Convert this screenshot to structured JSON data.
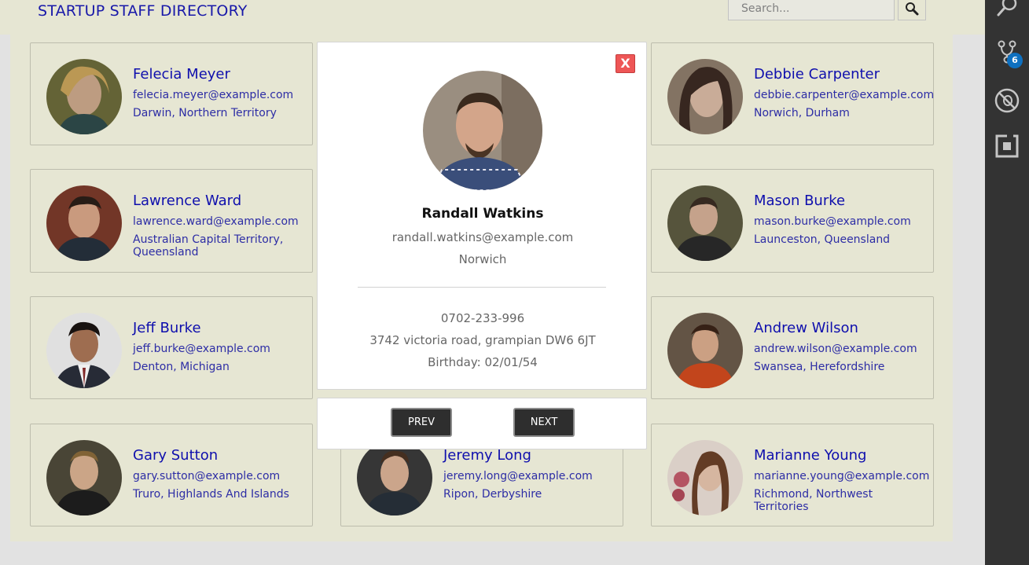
{
  "header": {
    "title": "STARTUP STAFF DIRECTORY",
    "search_placeholder": "Search..."
  },
  "cards": [
    {
      "name": "Felecia Meyer",
      "email": "felecia.meyer@example.com",
      "location": "Darwin, Northern Territory"
    },
    {
      "name": "Debbie Carpenter",
      "email": "debbie.carpenter@example.com",
      "location": "Norwich, Durham"
    },
    {
      "name": "Lawrence Ward",
      "email": "lawrence.ward@example.com",
      "location": "Australian Capital Territory, Queensland"
    },
    {
      "name": "Mason Burke",
      "email": "mason.burke@example.com",
      "location": "Launceston, Queensland"
    },
    {
      "name": "Jeff Burke",
      "email": "jeff.burke@example.com",
      "location": "Denton, Michigan"
    },
    {
      "name": "Andrew Wilson",
      "email": "andrew.wilson@example.com",
      "location": "Swansea, Herefordshire"
    },
    {
      "name": "Gary Sutton",
      "email": "gary.sutton@example.com",
      "location": "Truro, Highlands And Islands"
    },
    {
      "name": "Jeremy Long",
      "email": "jeremy.long@example.com",
      "location": "Ripon, Derbyshire"
    },
    {
      "name": "Marianne Young",
      "email": "marianne.young@example.com",
      "location": "Richmond, Northwest Territories"
    }
  ],
  "modal": {
    "close_label": "X",
    "name": "Randall Watkins",
    "email": "randall.watkins@example.com",
    "city": "Norwich",
    "phone": "0702-233-996",
    "address": "3742 victoria road, grampian DW6 6JT",
    "birthday": "Birthday: 02/01/54",
    "prev_label": "PREV",
    "next_label": "NEXT"
  },
  "activity_bar": {
    "icons": [
      "search-icon",
      "source-control-icon",
      "debug-icon",
      "extensions-icon"
    ],
    "source_control_badge": "6",
    "background": "#333333",
    "badge_color": "#0e70c0"
  },
  "colors": {
    "header_bg": "#f5f5e1",
    "brand_text": "#1a1ab4",
    "close_button": "#ee5656",
    "nav_button": "#2e2e2e"
  }
}
